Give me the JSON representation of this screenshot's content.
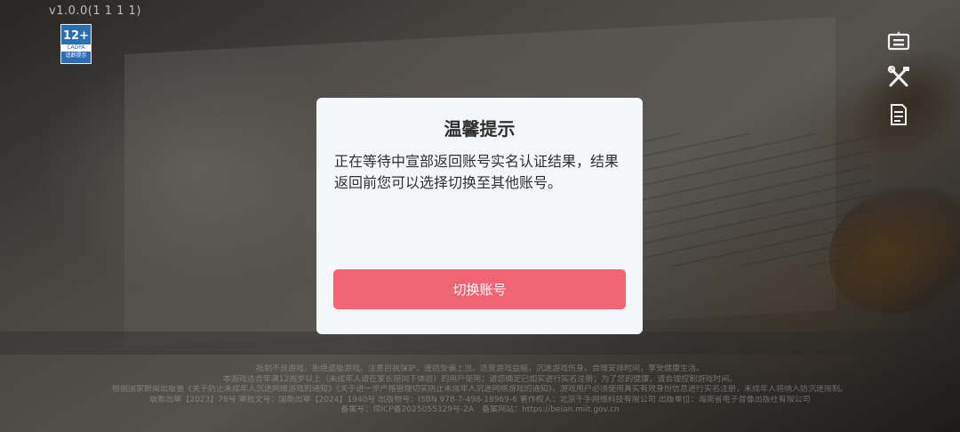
{
  "version": "v1.0.0(1 1 1 1)",
  "age_rating": {
    "number": "12+",
    "org": "CADPA",
    "tip": "适龄提示"
  },
  "side_icons": [
    "announcement-icon",
    "tools-icon",
    "notes-icon"
  ],
  "dialog": {
    "title": "温馨提示",
    "message": "正在等待中宣部返回账号实名认证结果，结果返回前您可以选择切换至其他账号。",
    "button_label": "切换账号"
  },
  "legal_text": [
    "抵制不良游戏，拒绝盗版游戏。注意自我保护，谨防受骗上当。适度游戏益脑，沉迷游戏伤身。合理安排时间，享受健康生活。",
    "本游戏适合年满12周岁以上（未成年人请在家长陪同下体验）的用户使用；请您确定已如实进行实名注册；为了您的健康，请合理控制游戏时间。",
    "根据国家新闻出版署《关于防止未成年人沉迷网络游戏的通知》《关于进一步严格管理切实防止未成年人沉迷网络游戏的通知》，游戏用户必须使用真实有效身份信息进行实名注册，未成年人将纳入防沉迷限制。",
    "版新出审【2023】78号 审批文号：国新出审【2024】1940号 出版物号：ISBN 978-7-498-18969-6 著作权人：北京千手网络科技有限公司 出版单位：海南省电子音像出版社有限公司",
    "备案号：琼ICP备2025055329号-2A　备案网站：https://beian.miit.gov.cn"
  ]
}
